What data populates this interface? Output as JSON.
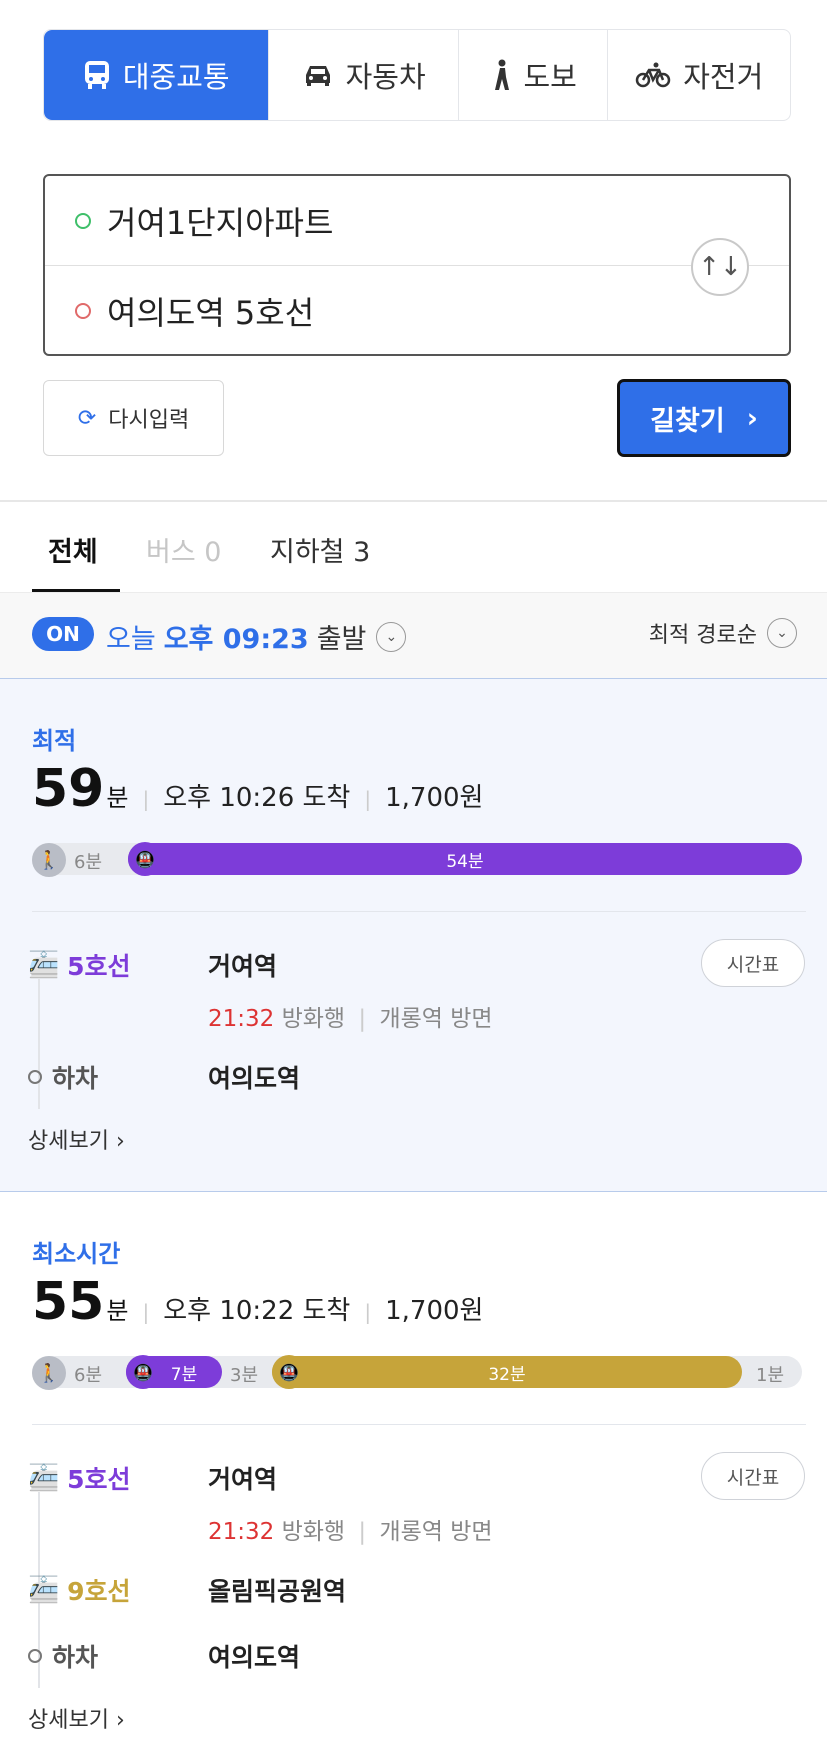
{
  "modes": [
    {
      "label": "대중교통",
      "icon": "bus-icon",
      "active": true
    },
    {
      "label": "자동차",
      "icon": "car-icon",
      "active": false
    },
    {
      "label": "도보",
      "icon": "walk-icon",
      "active": false
    },
    {
      "label": "자전거",
      "icon": "bicycle-icon",
      "active": false
    }
  ],
  "route": {
    "origin": "거여1단지아파트",
    "destination": "여의도역 5호선",
    "swap_glyph": "↑↓"
  },
  "actions": {
    "reset_label": "다시입력",
    "search_label": "길찾기"
  },
  "result_tabs": [
    {
      "label": "전체"
    },
    {
      "label": "버스 0"
    },
    {
      "label": "지하철 3"
    }
  ],
  "options": {
    "realtime_badge": "ON",
    "day": "오늘",
    "time": "오후 09:23",
    "depart_word": "출발",
    "sort_label": "최적 경로순"
  },
  "routes": [
    {
      "label": "최적",
      "minutes": "59",
      "unit": "분",
      "arrival": "오후 10:26 도착",
      "fare": "1,700원",
      "bar": {
        "walk_start": "6분",
        "seg1": "54분"
      },
      "steps": [
        {
          "line": "5호선",
          "station": "거여역",
          "time": "21:32",
          "direction": "방화행",
          "exit": "개롱역 방면"
        },
        {
          "off": "하차",
          "station": "여의도역"
        }
      ],
      "timetable_label": "시간표",
      "details_label": "상세보기"
    },
    {
      "label": "최소시간",
      "minutes": "55",
      "unit": "분",
      "arrival": "오후 10:22 도착",
      "fare": "1,700원",
      "bar": {
        "walk_start": "6분",
        "seg1": "7분",
        "transfer": "3분",
        "seg2": "32분",
        "walk_end": "1분"
      },
      "steps": [
        {
          "line": "5호선",
          "station": "거여역",
          "time": "21:32",
          "direction": "방화행",
          "exit": "개롱역 방면"
        },
        {
          "line": "9호선",
          "station": "올림픽공원역"
        },
        {
          "off": "하차",
          "station": "여의도역"
        }
      ],
      "timetable_label": "시간표",
      "details_label": "상세보기"
    }
  ],
  "colors": {
    "accent": "#2f6fe8",
    "line5": "#7d3cd9",
    "line9": "#c6a43a",
    "time_red": "#d33333"
  }
}
